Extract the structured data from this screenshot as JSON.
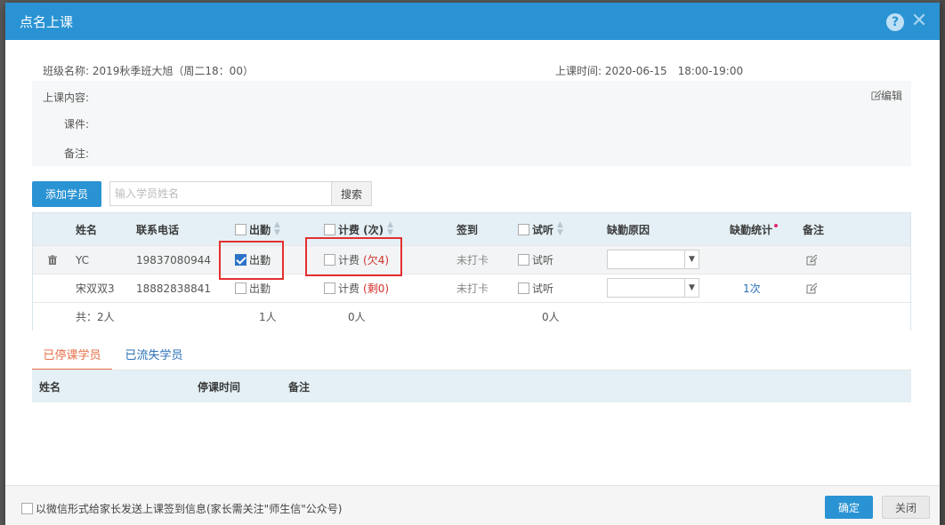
{
  "dialog": {
    "title": "点名上课"
  },
  "meta": {
    "class_name_label": "班级名称:",
    "class_name_value": "2019秋季班大旭（周二18：00）",
    "class_time_label": "上课时间:",
    "class_time_value": "2020-06-15　18:00-19:00"
  },
  "info": {
    "content_label": "上课内容:",
    "courseware_label": "课件:",
    "remark_label": "备注:",
    "edit_label": "编辑"
  },
  "toolbar": {
    "add_student_label": "添加学员",
    "search_placeholder": "输入学员姓名",
    "search_label": "搜索"
  },
  "table": {
    "headers": {
      "name": "姓名",
      "phone": "联系电话",
      "attend": "出勤",
      "billing": "计费 (次)",
      "signin": "签到",
      "trial": "试听",
      "absence_reason": "缺勤原因",
      "absence_stats": "缺勤统计",
      "remark": "备注"
    },
    "rows": [
      {
        "name": "YC",
        "phone": "19837080944",
        "attend_label": "出勤",
        "billing_label": "计费",
        "billing_status": "(欠4)",
        "signin": "未打卡",
        "trial_label": "试听",
        "absence_stats": ""
      },
      {
        "name": "宋双双3",
        "phone": "18882838841",
        "attend_label": "出勤",
        "billing_label": "计费",
        "billing_status": "(剩0)",
        "signin": "未打卡",
        "trial_label": "试听",
        "absence_stats": "1次"
      }
    ],
    "totals": {
      "name": "共：2人",
      "attend": "1人",
      "billing": "0人",
      "trial": "0人"
    }
  },
  "tabs": [
    {
      "label": "已停课学员"
    },
    {
      "label": "已流失学员"
    }
  ],
  "stopped_table": {
    "headers": {
      "name": "姓名",
      "stop_time": "停课时间",
      "remark": "备注"
    }
  },
  "footer": {
    "wechat_notice_label": "以微信形式给家长发送上课签到信息(家长需关注\"师生信\"公众号)",
    "ok_label": "确定",
    "close_label": "关闭"
  }
}
